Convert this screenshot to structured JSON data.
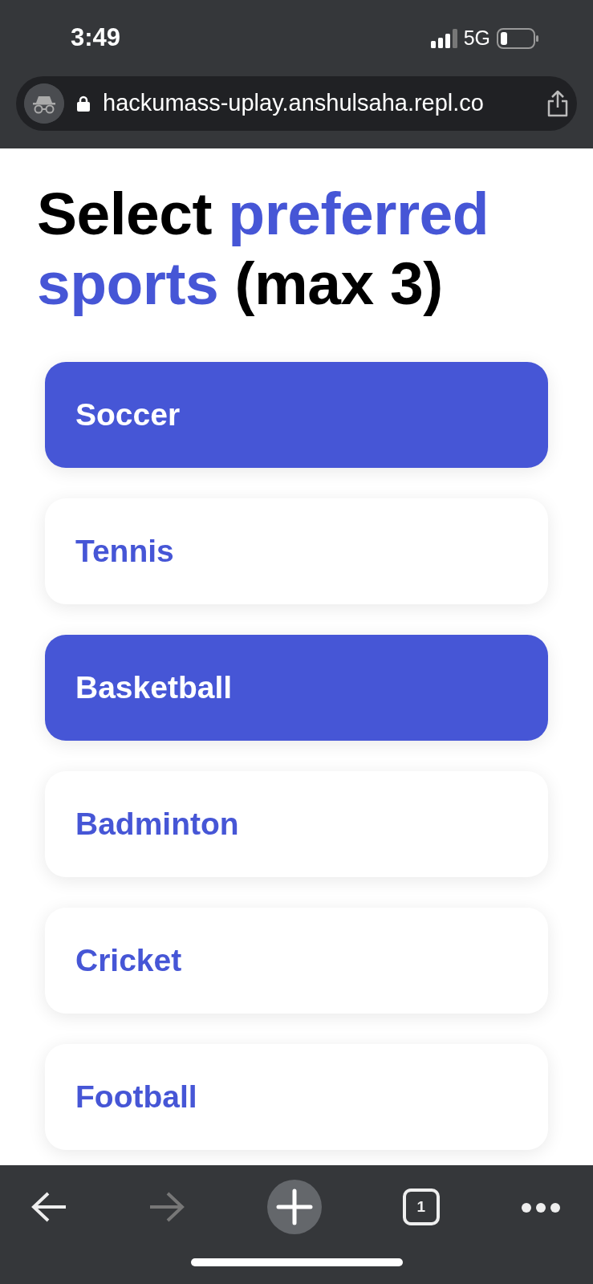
{
  "status_bar": {
    "time": "3:49",
    "network": "5G"
  },
  "address_bar": {
    "url": "hackumass-uplay.anshulsaha.repl.co",
    "incognito": true
  },
  "heading": [
    {
      "text": "Select ",
      "highlight": false
    },
    {
      "text": "preferred sports",
      "highlight": true
    },
    {
      "text": " (max 3)",
      "highlight": false
    }
  ],
  "options": [
    {
      "label": "Soccer",
      "selected": true
    },
    {
      "label": "Tennis",
      "selected": false
    },
    {
      "label": "Basketball",
      "selected": true
    },
    {
      "label": "Badminton",
      "selected": false
    },
    {
      "label": "Cricket",
      "selected": false
    },
    {
      "label": "Football",
      "selected": false
    }
  ],
  "toolbar": {
    "back_disabled": false,
    "forward_disabled": true,
    "tab_count": "1"
  }
}
